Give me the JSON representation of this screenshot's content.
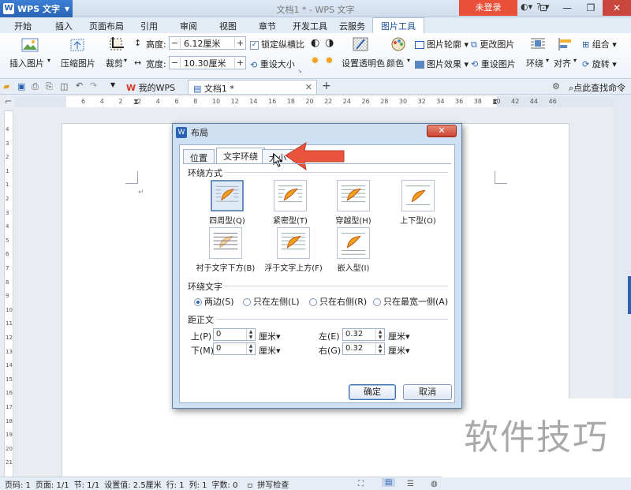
{
  "app": {
    "name": "WPS 文字",
    "window_title": "文档1 * - WPS 文字",
    "login_label": "未登录"
  },
  "tabs": [
    "开始",
    "插入",
    "页面布局",
    "引用",
    "审阅",
    "视图",
    "章节",
    "开发工具",
    "云服务",
    "图片工具"
  ],
  "active_tab": "图片工具",
  "ribbon": {
    "insert_image": "插入图片",
    "compress_image": "压缩图片",
    "crop": "裁剪",
    "height_label": "高度:",
    "height_value": "6.12厘米",
    "width_label": "宽度:",
    "width_value": "10.30厘米",
    "lock_ratio": "锁定纵横比",
    "reset_size": "重设大小",
    "set_transparent": "设置透明色",
    "color": "颜色",
    "image_outline": "图片轮廓",
    "image_effect": "图片效果",
    "change_image": "更改图片",
    "reset_image": "重设图片",
    "wrap": "环绕",
    "align": "对齐",
    "group": "组合",
    "rotate": "旋转"
  },
  "doc_tabs": [
    "我的WPS",
    "文档1 *"
  ],
  "search_label": "点此查找命令",
  "ruler_numbers": [
    "6",
    "4",
    "2",
    "2",
    "4",
    "6",
    "8",
    "10",
    "12",
    "14",
    "16",
    "18",
    "20",
    "22",
    "24",
    "26",
    "28",
    "30",
    "32",
    "34",
    "36",
    "38",
    "40",
    "42",
    "44",
    "46"
  ],
  "vruler_numbers": [
    "4",
    "3",
    "2",
    "1",
    "1",
    "2",
    "3",
    "4",
    "5",
    "6",
    "7",
    "8",
    "9",
    "10",
    "11",
    "12",
    "13",
    "14",
    "15",
    "16",
    "17",
    "18",
    "19",
    "20",
    "21"
  ],
  "dialog": {
    "title": "布局",
    "tabs": [
      "位置",
      "文字环绕",
      "大小"
    ],
    "active_tab": "文字环绕",
    "wrap_section": "环绕方式",
    "wrap_options": [
      "四周型(Q)",
      "紧密型(T)",
      "穿越型(H)",
      "上下型(O)",
      "衬于文字下方(B)",
      "浮于文字上方(F)",
      "嵌入型(I)"
    ],
    "wrap_selected": "四周型(Q)",
    "text_section": "环绕文字",
    "text_options": [
      "两边(S)",
      "只在左侧(L)",
      "只在右侧(R)",
      "只在最宽一侧(A)"
    ],
    "text_selected": "两边(S)",
    "distance_section": "距正文",
    "top_label": "上(P)",
    "top_value": "0",
    "top_unit": "厘米",
    "bottom_label": "下(M)",
    "bottom_value": "0",
    "bottom_unit": "厘米",
    "left_label": "左(E)",
    "left_value": "0.32",
    "left_unit": "厘米",
    "right_label": "右(G)",
    "right_value": "0.32",
    "right_unit": "厘米",
    "ok": "确定",
    "cancel": "取消"
  },
  "status": {
    "page_code": "页码: 1",
    "pages": "页面: 1/1",
    "section": "节: 1/1",
    "setting": "设置值: 2.5厘米",
    "row": "行: 1",
    "col": "列: 1",
    "words": "字数: 0",
    "spell": "拼写检查"
  },
  "watermark": "软件技巧",
  "colors": {
    "accent": "#2a63b5",
    "arrow": "#e8543d",
    "login": "#e9503a"
  }
}
